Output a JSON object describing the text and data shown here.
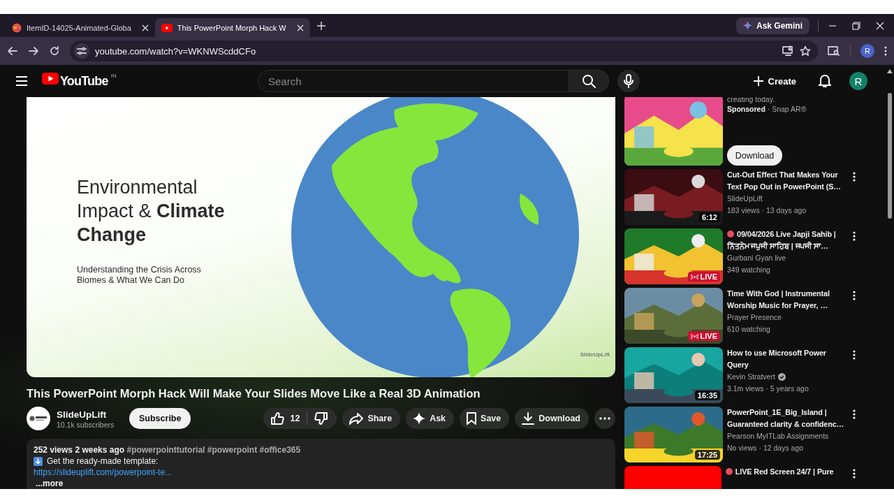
{
  "browser": {
    "tabs": [
      {
        "title": "ItemID-14025-Animated-Globa",
        "selected": false
      },
      {
        "title": "This PowerPoint Morph Hack W",
        "selected": true
      }
    ],
    "ask_gemini": "Ask Gemini",
    "address": "youtube.com/watch?v=WKNWScddCFo",
    "profile_initial": "R"
  },
  "header": {
    "logo": "YouTube",
    "country": "IN",
    "search": {
      "placeholder": "Search"
    },
    "create": "Create",
    "avatar_initial": "R"
  },
  "video": {
    "slide": {
      "title": "Environmental Impact & **Climate Change**",
      "subtitle": "Understanding the Crisis Across Biomes & What We Can Do",
      "brand": "SlideUpLift"
    },
    "title": "This PowerPoint Morph Hack Will Make Your Slides Move Like a Real 3D Animation",
    "channel": {
      "name": "SlideUpLift",
      "subscribers": "10.1k subscribers"
    },
    "subscribe": "Subscribe",
    "likes": "12",
    "actions": [
      {
        "kind": "share",
        "label": "Share"
      },
      {
        "kind": "ask",
        "label": "Ask"
      },
      {
        "kind": "save",
        "label": "Save"
      },
      {
        "kind": "download",
        "label": "Download"
      }
    ],
    "description": {
      "views": "252 views",
      "age": "2 weeks ago",
      "hashtags": [
        "#powerpointtutorial",
        "#powerpoint",
        "#office365"
      ],
      "line": "Get the ready-made template:",
      "link": "https://slideuplift.com/powerpoint-te...",
      "more": "...more"
    }
  },
  "sidebar": {
    "ad": {
      "text": "creating today.",
      "sponsored": "Sponsored",
      "separator": "·",
      "advertiser": "Snap AR®",
      "button": "Download"
    },
    "videos": [
      {
        "title": "Cut-Out Effect That Makes Your Text Pop Out in PowerPoint (S…",
        "live_dot": false,
        "channel": "SlideUpLift",
        "verified": false,
        "meta": "183 views · 13 days ago",
        "badge": {
          "kind": "duration",
          "text": "6:12"
        }
      },
      {
        "title": "09/04/2026 Live Japji Sahib | ਨਿੱਤਨੇਮ ਜਪੁਜੀ ਸਾਹਿਬ | ਜਪਜੀ ਸਾ…",
        "live_dot": true,
        "channel": "Gurbani Gyan live",
        "verified": false,
        "meta": "349 watching",
        "badge": {
          "kind": "live",
          "text": "LIVE"
        }
      },
      {
        "title": "Time With God | Instrumental Worship Music for Prayer, …",
        "live_dot": false,
        "channel": "Prayer Presence",
        "verified": false,
        "meta": "610 watching",
        "badge": {
          "kind": "live",
          "text": "LIVE"
        }
      },
      {
        "title": "How to use Microsoft Power Query",
        "live_dot": false,
        "channel": "Kevin Stratvert",
        "verified": true,
        "meta": "3.1m views · 5 years ago",
        "badge": {
          "kind": "duration",
          "text": "16:35"
        }
      },
      {
        "title": "PowerPoint_1E_Big_Island | Guaranteed clarity & confidenc…",
        "live_dot": false,
        "channel": "Pearson MyITLab Assignments",
        "verified": false,
        "meta": "No views · 12 days ago",
        "badge": {
          "kind": "duration",
          "text": "17:25"
        }
      },
      {
        "title": "LIVE Red Screen 24/7 | Pure",
        "live_dot": true,
        "kind": "flat"
      }
    ]
  }
}
